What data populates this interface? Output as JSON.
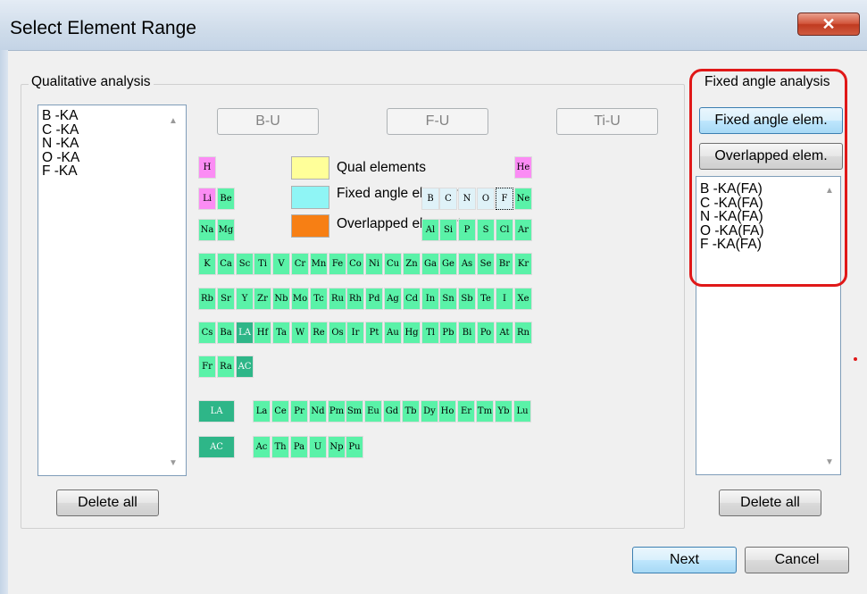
{
  "window": {
    "title": "Select Element Range",
    "close_glyph": "✕"
  },
  "qualitative": {
    "label": "Qualitative analysis",
    "items": [
      "B -KA",
      "C -KA",
      "N -KA",
      "O -KA",
      "F -KA"
    ],
    "delete_label": "Delete all"
  },
  "range_buttons": {
    "bu": "B-U",
    "fu": "F-U",
    "tiu": "Ti-U"
  },
  "legend": {
    "qual": "Qual elements",
    "fixed": "Fixed angle elements",
    "overlapped": "Overlapped elements",
    "colors": {
      "qual": "#ffff99",
      "fixed": "#8ff5f5",
      "overlapped": "#f77f14"
    }
  },
  "table_colors": {
    "qual": "#fb8cf4",
    "fixed": "#5af2a8",
    "dark": "#2eb688",
    "placeholder": "#dff2f8"
  },
  "periodic": {
    "main": [
      [
        "H",
        "",
        "",
        "",
        "",
        "",
        "",
        "",
        "",
        "",
        "",
        "",
        "",
        "",
        "",
        "",
        "",
        "He"
      ],
      [
        "Li",
        "Be",
        "",
        "",
        "",
        "",
        "",
        "",
        "",
        "",
        "",
        "",
        "B",
        "C",
        "N",
        "O",
        "F",
        "Ne"
      ],
      [
        "Na",
        "Mg",
        "",
        "",
        "",
        "",
        "",
        "",
        "",
        "",
        "",
        "",
        "Al",
        "Si",
        "P",
        "S",
        "Cl",
        "Ar"
      ],
      [
        "K",
        "Ca",
        "Sc",
        "Ti",
        "V",
        "Cr",
        "Mn",
        "Fe",
        "Co",
        "Ni",
        "Cu",
        "Zn",
        "Ga",
        "Ge",
        "As",
        "Se",
        "Br",
        "Kr"
      ],
      [
        "Rb",
        "Sr",
        "Y",
        "Zr",
        "Nb",
        "Mo",
        "Tc",
        "Ru",
        "Rh",
        "Pd",
        "Ag",
        "Cd",
        "In",
        "Sn",
        "Sb",
        "Te",
        "I",
        "Xe"
      ],
      [
        "Cs",
        "Ba",
        "LA",
        "Hf",
        "Ta",
        "W",
        "Re",
        "Os",
        "Ir",
        "Pt",
        "Au",
        "Hg",
        "Tl",
        "Pb",
        "Bi",
        "Po",
        "At",
        "Rn"
      ],
      [
        "Fr",
        "Ra",
        "AC",
        "",
        "",
        "",
        "",
        "",
        "",
        "",
        "",
        "",
        "",
        "",
        "",
        "",
        "",
        ""
      ]
    ],
    "lanthanide_label": "LA",
    "lanthanides": [
      "La",
      "Ce",
      "Pr",
      "Nd",
      "Pm",
      "Sm",
      "Eu",
      "Gd",
      "Tb",
      "Dy",
      "Ho",
      "Er",
      "Tm",
      "Yb",
      "Lu"
    ],
    "actinide_label": "AC",
    "actinides": [
      "Ac",
      "Th",
      "Pa",
      "U",
      "Np",
      "Pu"
    ],
    "qual_elements": [
      "H",
      "He",
      "Li"
    ],
    "placeholder_elements": [
      "B",
      "C",
      "N",
      "O",
      "F"
    ],
    "focused_element": "F",
    "dark_elements": [
      "LA",
      "AC"
    ]
  },
  "fixed_angle": {
    "label": "Fixed angle analysis",
    "fixed_btn": "Fixed angle elem.",
    "overlap_btn": "Overlapped elem.",
    "items": [
      "B -KA(FA)",
      "C -KA(FA)",
      "N -KA(FA)",
      "O -KA(FA)",
      "F -KA(FA)"
    ],
    "delete_label": "Delete all",
    "highlight_color": "#e01818"
  },
  "footer": {
    "next": "Next",
    "cancel": "Cancel"
  }
}
